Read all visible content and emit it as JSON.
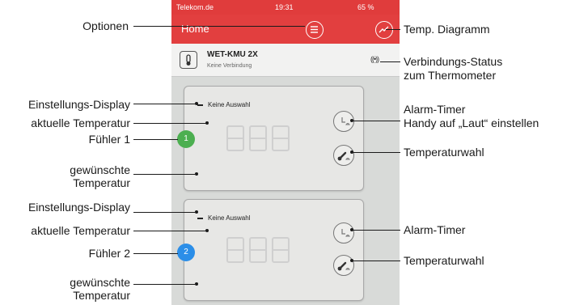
{
  "phone": {
    "status": {
      "carrier": "Telekom.de",
      "time": "19:31",
      "battery": "65 %"
    },
    "nav": {
      "title": "Home",
      "options_icon": "list-icon",
      "chart_icon": "trend-chart-icon"
    },
    "device": {
      "name": "WET-KMU 2X",
      "connection": "Keine Verbindung",
      "signal_icon": "signal-icon"
    },
    "probes": [
      {
        "number": "1",
        "color": "#4caf50",
        "selection": "Keine Auswahl",
        "reading": "888"
      },
      {
        "number": "2",
        "color": "#2b8ee8",
        "selection": "Keine Auswahl",
        "reading": "888"
      }
    ]
  },
  "left_labels": {
    "options": "Optionen",
    "settings_display_1": "Einstellungs-Display",
    "current_temp_1": "aktuelle Temperatur",
    "probe_1": "Fühler 1",
    "desired_temp_1_a": "gewünschte",
    "desired_temp_1_b": "Temperatur",
    "settings_display_2": "Einstellungs-Display",
    "current_temp_2": "aktuelle Temperatur",
    "probe_2": "Fühler 2",
    "desired_temp_2_a": "gewünschte",
    "desired_temp_2_b": "Temperatur"
  },
  "right_labels": {
    "temp_chart": "Temp. Diagramm",
    "connection_a": "Verbindungs-Status",
    "connection_b": "zum Thermometer",
    "alarm_1_a": "Alarm-Timer",
    "alarm_1_b": "Handy auf „Laut“ einstellen",
    "temp_select_1": "Temperaturwahl",
    "alarm_2": "Alarm-Timer",
    "temp_select_2": "Temperaturwahl"
  }
}
